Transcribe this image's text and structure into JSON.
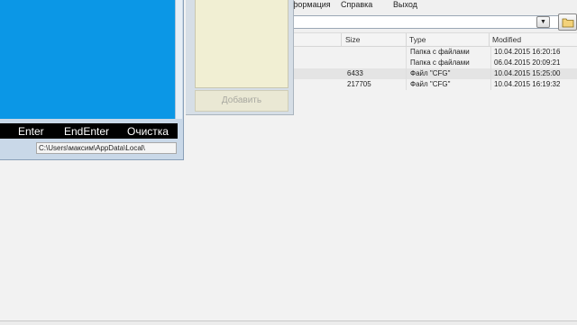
{
  "file_manager": {
    "menu": [
      "нформация",
      "Справка",
      "Выход"
    ],
    "columns": {
      "size": "Size",
      "type": "Type",
      "modified": "Modified"
    },
    "rows": [
      {
        "size": "",
        "type": "Папка с файлами",
        "modified": "10.04.2015 16:20:16"
      },
      {
        "size": "",
        "type": "Папка с файлами",
        "modified": "06.04.2015 20:09:21"
      },
      {
        "size": "6433",
        "type": "Файл \"CFG\"",
        "modified": "10.04.2015 15:25:00"
      },
      {
        "size": "217705",
        "type": "Файл \"CFG\"",
        "modified": "10.04.2015 16:19:32"
      }
    ],
    "selected_row_index": 2
  },
  "middle_panel": {
    "add_button": "Добавить"
  },
  "left_window": {
    "keys": [
      "Enter",
      "EndEnter",
      "Очистка"
    ],
    "path": "C:\\Users\\максим\\AppData\\Local\\"
  },
  "colors": {
    "console_blue": "#0b97e6",
    "beige": "#f1efd3"
  }
}
